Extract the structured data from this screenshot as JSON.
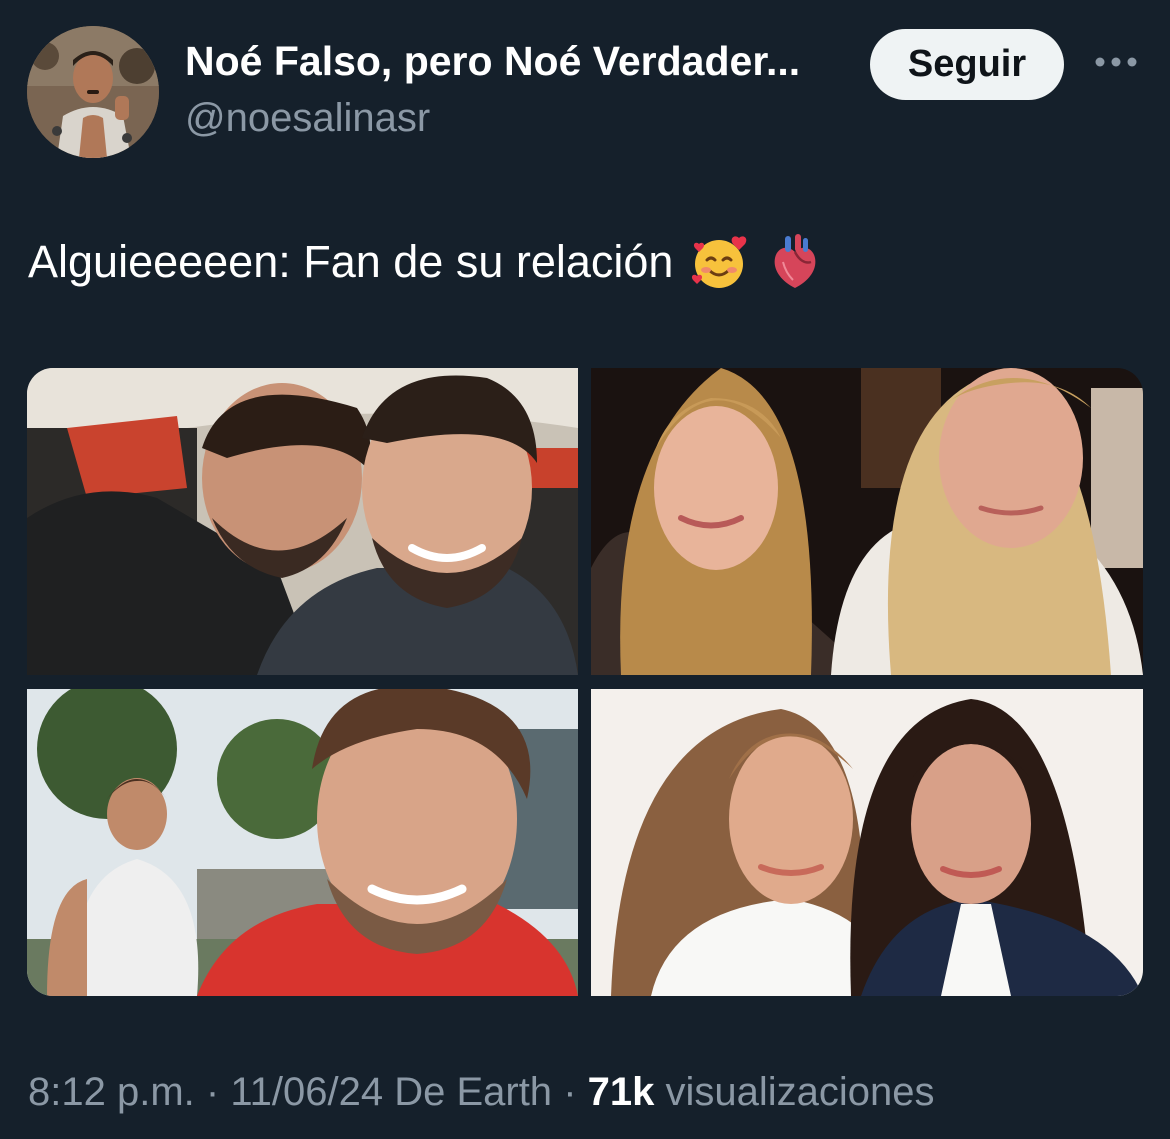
{
  "header": {
    "display_name": "Noé Falso, pero Noé Verdader...",
    "handle": "@noesalinasr",
    "follow_label": "Seguir",
    "more_icon": "ellipsis-icon"
  },
  "tweet": {
    "text": "Alguieeeeen: Fan de su relación",
    "emojis": [
      "smiling-face-with-hearts-emoji",
      "anatomical-heart-emoji"
    ]
  },
  "media": {
    "photos": [
      {
        "subject": "two men selfie on airplane"
      },
      {
        "subject": "two blonde women portrait"
      },
      {
        "subject": "man in tank top and man in red shirt selfie outdoors"
      },
      {
        "subject": "two women in white and navy blazers"
      }
    ]
  },
  "footer": {
    "time": "8:12 p.m.",
    "date": "11/06/24",
    "source": "De Earth",
    "views_count": "71k",
    "views_label": "visualizaciones",
    "separator": "·"
  },
  "colors": {
    "background": "#15202b",
    "text_primary": "#ffffff",
    "text_secondary": "#8b98a5",
    "button_bg": "#eff3f4"
  }
}
